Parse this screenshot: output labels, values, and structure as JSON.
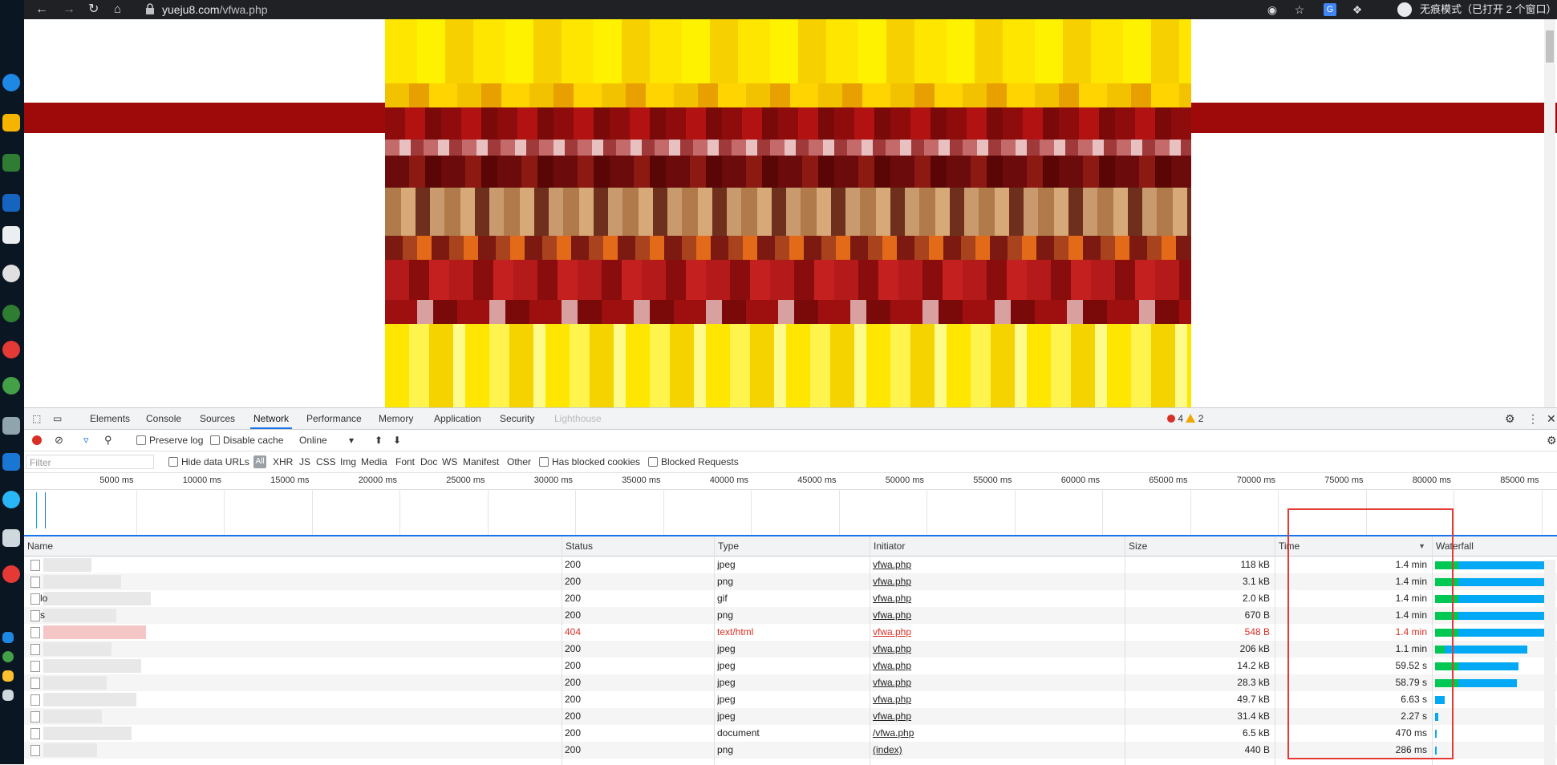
{
  "browser": {
    "url_host": "yueju8.com",
    "url_path": "/vfwa.php",
    "incognito_label": "无痕模式（已打开 2 个窗口）"
  },
  "devtools": {
    "tabs": [
      "Elements",
      "Console",
      "Sources",
      "Network",
      "Performance",
      "Memory",
      "Application",
      "Security",
      "Lighthouse"
    ],
    "active_tab": "Network",
    "errors": "4",
    "warnings": "2",
    "toolbar": {
      "preserve_log": "Preserve log",
      "disable_cache": "Disable cache",
      "throttling": "Online"
    },
    "filterbar": {
      "filter_placeholder": "Filter",
      "hide_data_urls": "Hide data URLs",
      "all": "All",
      "types": [
        "XHR",
        "JS",
        "CSS",
        "Img",
        "Media",
        "Font",
        "Doc",
        "WS",
        "Manifest",
        "Other"
      ],
      "has_blocked_cookies": "Has blocked cookies",
      "blocked_requests": "Blocked Requests"
    },
    "overview_ticks": [
      "5000 ms",
      "10000 ms",
      "15000 ms",
      "20000 ms",
      "25000 ms",
      "30000 ms",
      "35000 ms",
      "40000 ms",
      "45000 ms",
      "50000 ms",
      "55000 ms",
      "60000 ms",
      "65000 ms",
      "70000 ms",
      "75000 ms",
      "80000 ms",
      "85000 ms"
    ],
    "columns": [
      "Name",
      "Status",
      "Type",
      "Initiator",
      "Size",
      "Time",
      "Waterfall"
    ],
    "rows": [
      {
        "name": "",
        "status": "200",
        "type": "jpeg",
        "initiator": "vfwa.php",
        "size": "118 kB",
        "time": "1.4 min",
        "wait": 0.2,
        "total": 1.0
      },
      {
        "name": "",
        "status": "200",
        "type": "png",
        "initiator": "vfwa.php",
        "size": "3.1 kB",
        "time": "1.4 min",
        "wait": 0.2,
        "total": 1.0
      },
      {
        "name": "lo",
        "status": "200",
        "type": "gif",
        "initiator": "vfwa.php",
        "size": "2.0 kB",
        "time": "1.4 min",
        "wait": 0.2,
        "total": 1.0
      },
      {
        "name": "s",
        "status": "200",
        "type": "png",
        "initiator": "vfwa.php",
        "size": "670 B",
        "time": "1.4 min",
        "wait": 0.2,
        "total": 1.0
      },
      {
        "name": "",
        "status": "404",
        "type": "text/html",
        "initiator": "vfwa.php",
        "size": "548 B",
        "time": "1.4 min",
        "wait": 0.2,
        "total": 1.0
      },
      {
        "name": "",
        "status": "200",
        "type": "jpeg",
        "initiator": "vfwa.php",
        "size": "206 kB",
        "time": "1.1 min",
        "wait": 0.08,
        "total": 0.79
      },
      {
        "name": "",
        "status": "200",
        "type": "jpeg",
        "initiator": "vfwa.php",
        "size": "14.2 kB",
        "time": "59.52 s",
        "wait": 0.2,
        "total": 0.71
      },
      {
        "name": "",
        "status": "200",
        "type": "jpeg",
        "initiator": "vfwa.php",
        "size": "28.3 kB",
        "time": "58.79 s",
        "wait": 0.2,
        "total": 0.7
      },
      {
        "name": "",
        "status": "200",
        "type": "jpeg",
        "initiator": "vfwa.php",
        "size": "49.7 kB",
        "time": "6.63 s",
        "wait": 0.0,
        "total": 0.08
      },
      {
        "name": "",
        "status": "200",
        "type": "jpeg",
        "initiator": "vfwa.php",
        "size": "31.4 kB",
        "time": "2.27 s",
        "wait": 0.0,
        "total": 0.03
      },
      {
        "name": "",
        "status": "200",
        "type": "document",
        "initiator": "/vfwa.php",
        "size": "6.5 kB",
        "time": "470 ms",
        "wait": 0.0,
        "total": 0.01
      },
      {
        "name": "",
        "status": "200",
        "type": "png",
        "initiator": "(index)",
        "size": "440 B",
        "time": "286 ms",
        "wait": 0.0,
        "total": 0.01
      }
    ]
  }
}
